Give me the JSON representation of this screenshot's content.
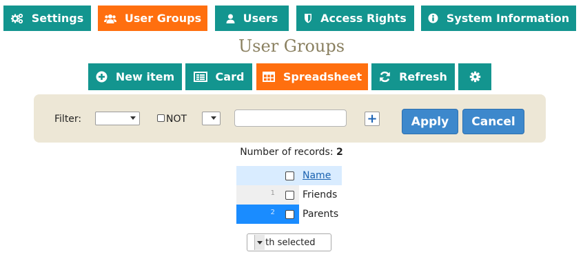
{
  "nav": {
    "settings": "Settings",
    "user_groups": "User Groups",
    "users": "Users",
    "access_rights": "Access Rights",
    "system_information": "System Information"
  },
  "page_title": "User Groups",
  "toolbar": {
    "new_item": "New item",
    "card": "Card",
    "spreadsheet": "Spreadsheet",
    "refresh": "Refresh"
  },
  "filter": {
    "label": "Filter:",
    "not_label": "NOT",
    "field_value": "",
    "operator_value": "",
    "text_value": "",
    "add_symbol": "+",
    "apply": "Apply",
    "cancel": "Cancel"
  },
  "records": {
    "label": "Number of records:",
    "count": "2"
  },
  "table": {
    "header_name": "Name",
    "rows": [
      {
        "num": "1",
        "name": "Friends"
      },
      {
        "num": "2",
        "name": "Parents"
      }
    ]
  },
  "with_selected": "With selected",
  "colors": {
    "teal": "#13958f",
    "orange": "#ff6f0f",
    "blue_button": "#3d88cc",
    "selected_row": "#1a8cff",
    "filter_panel": "#ede7d6"
  }
}
